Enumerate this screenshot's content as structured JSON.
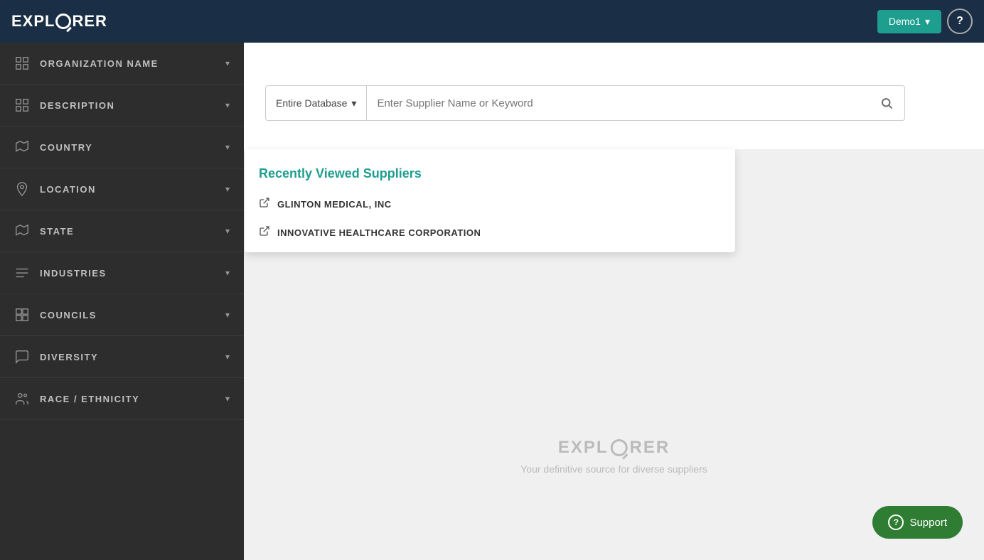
{
  "header": {
    "logo": "EXPLORER",
    "user": "Demo1",
    "help_label": "?",
    "chevron": "▾"
  },
  "sidebar": {
    "items": [
      {
        "id": "organization-name",
        "label": "ORGANIZATION NAME",
        "icon": "grid",
        "has_chevron": true
      },
      {
        "id": "description",
        "label": "DESCRIPTION",
        "icon": "grid",
        "has_chevron": true
      },
      {
        "id": "country",
        "label": "COUNTRY",
        "icon": "arrow-up-right",
        "has_chevron": true
      },
      {
        "id": "location",
        "label": "LOCATION",
        "icon": "location-pin",
        "has_chevron": true
      },
      {
        "id": "state",
        "label": "STATE",
        "icon": "arrow-up-right",
        "has_chevron": true
      },
      {
        "id": "industries",
        "label": "INDUSTRIES",
        "icon": "list",
        "has_chevron": true
      },
      {
        "id": "councils",
        "label": "COUNCILS",
        "icon": "grid-4",
        "has_chevron": true
      },
      {
        "id": "diversity",
        "label": "DIVERSITY",
        "icon": "chat",
        "has_chevron": true
      },
      {
        "id": "race-ethnicity",
        "label": "RACE / ETHNICITY",
        "icon": "people",
        "has_chevron": true
      }
    ]
  },
  "search": {
    "database_label": "Entire Database",
    "placeholder": "Enter Supplier Name or Keyword",
    "chevron": "▾"
  },
  "dropdown": {
    "title": "Recently Viewed Suppliers",
    "items": [
      {
        "label": "GLINTON MEDICAL, INC"
      },
      {
        "label": "INNOVATIVE HEALTHCARE CORPORATION"
      }
    ]
  },
  "watermark": {
    "logo": "EXPLORER",
    "subtitle": "Your definitive source for diverse suppliers"
  },
  "support": {
    "label": "Support",
    "icon": "?"
  }
}
